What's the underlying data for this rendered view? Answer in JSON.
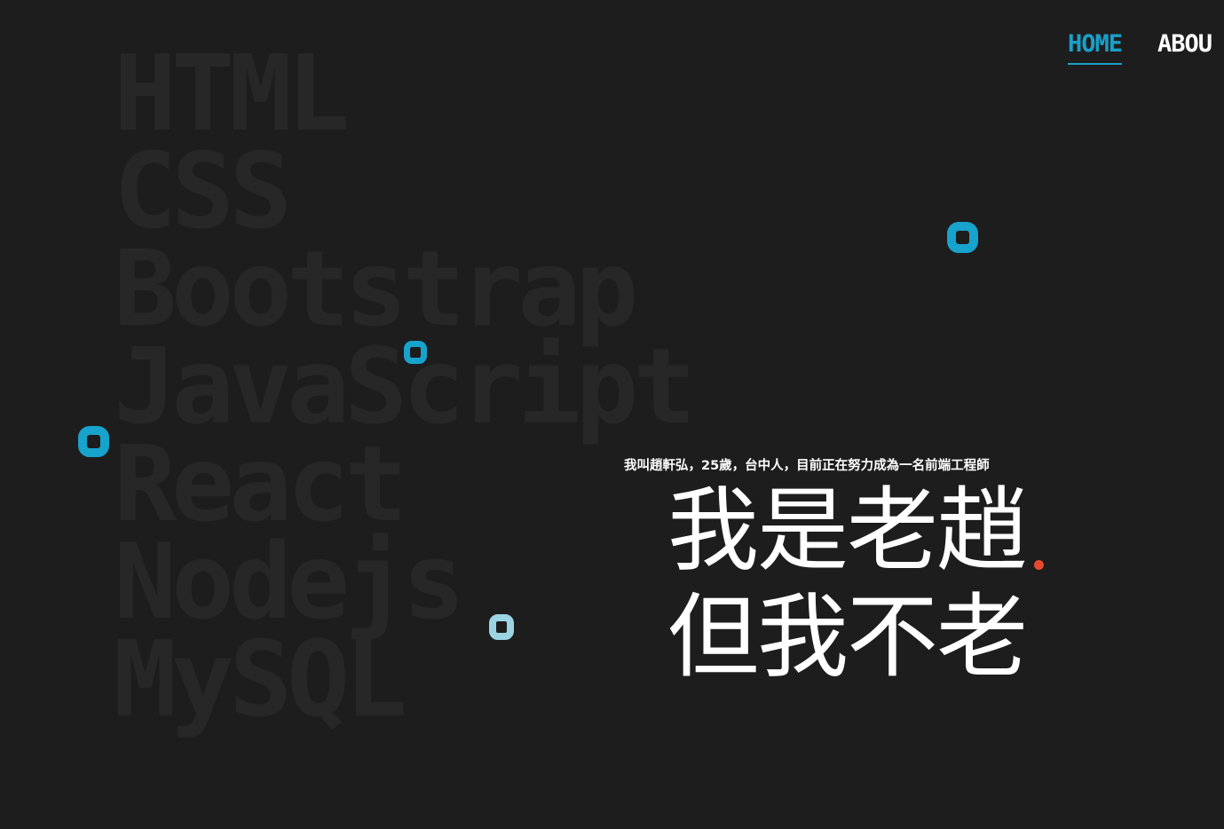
{
  "nav": {
    "home": "HOME",
    "about": "ABOU"
  },
  "background_words": [
    "HTML",
    "CSS",
    "Bootstrap",
    "JavaScript",
    "React",
    "Nodejs",
    "MySQL"
  ],
  "hero": {
    "intro": "我叫趙軒弘，25歲，台中人，目前正在努力成為一名前端工程師",
    "line1": "我是老趙",
    "line2": "但我不老"
  },
  "colors": {
    "background": "#1d1d1d",
    "accent": "#1aa0c8",
    "dot": "#e64a2e",
    "ring_light": "#9cd3e3"
  }
}
